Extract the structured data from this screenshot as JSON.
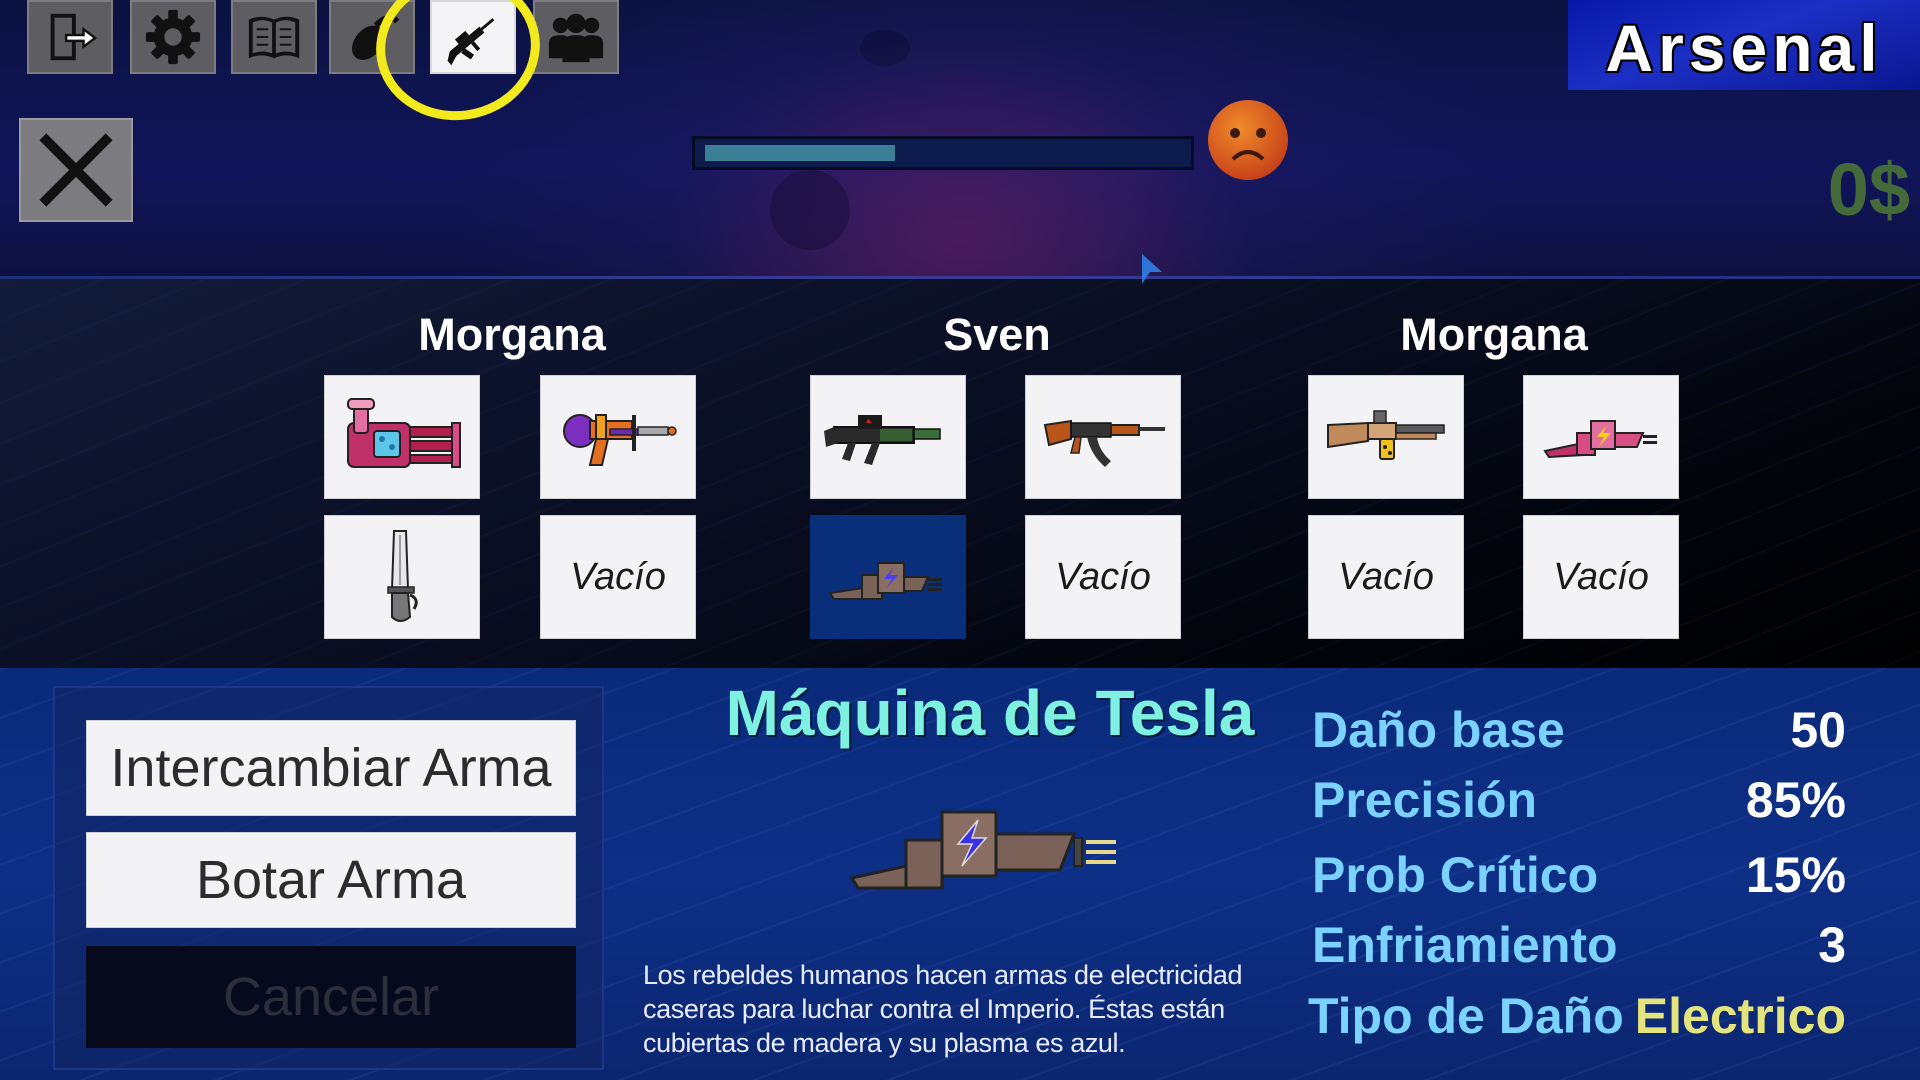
{
  "title": "Arsenal",
  "money": "0$",
  "progress_fraction": 0.4,
  "mood": "sad-face",
  "toolbar": [
    {
      "name": "exit-icon"
    },
    {
      "name": "gear-icon"
    },
    {
      "name": "journal-icon"
    },
    {
      "name": "grenade-icon"
    },
    {
      "name": "rifle-icon",
      "active": true
    },
    {
      "name": "group-icon"
    }
  ],
  "characters": [
    {
      "name": "Morgana",
      "slots": [
        "minigun-icon",
        "ray-gun-icon",
        "knife-icon",
        "Vacío"
      ]
    },
    {
      "name": "Sven",
      "slots": [
        "assault-rifle-icon",
        "ak47-icon",
        "tesla-machine-icon",
        "Vacío"
      ]
    },
    {
      "name": "Morgana",
      "slots": [
        "shotgun-icon",
        "lightning-gun-icon",
        "Vacío",
        "Vacío"
      ]
    }
  ],
  "actions": {
    "swap": "Intercambiar Arma",
    "drop": "Botar Arma",
    "cancel": "Cancelar"
  },
  "weapon": {
    "name": "Máquina de Tesla",
    "description_lines": [
      "Los rebeldes humanos hacen armas de electricidad",
      "caseras para luchar contra el Imperio. Éstas están",
      "cubiertas de madera y su plasma es azul."
    ],
    "stats": [
      {
        "label": "Daño base",
        "value": "50"
      },
      {
        "label": "Precisión",
        "value": "85%"
      },
      {
        "label": "Prob Crítico",
        "value": "15%"
      },
      {
        "label": "Enfriamiento",
        "value": "3"
      },
      {
        "label": "Tipo de Daño",
        "value": "Electrico"
      }
    ]
  },
  "colors": {
    "accent_title": "#7ff1e0",
    "stat_label": "#7bd2ff",
    "damage_type": "#e4e47c",
    "highlight": "#f2ea1c",
    "money": "#456a3a"
  }
}
